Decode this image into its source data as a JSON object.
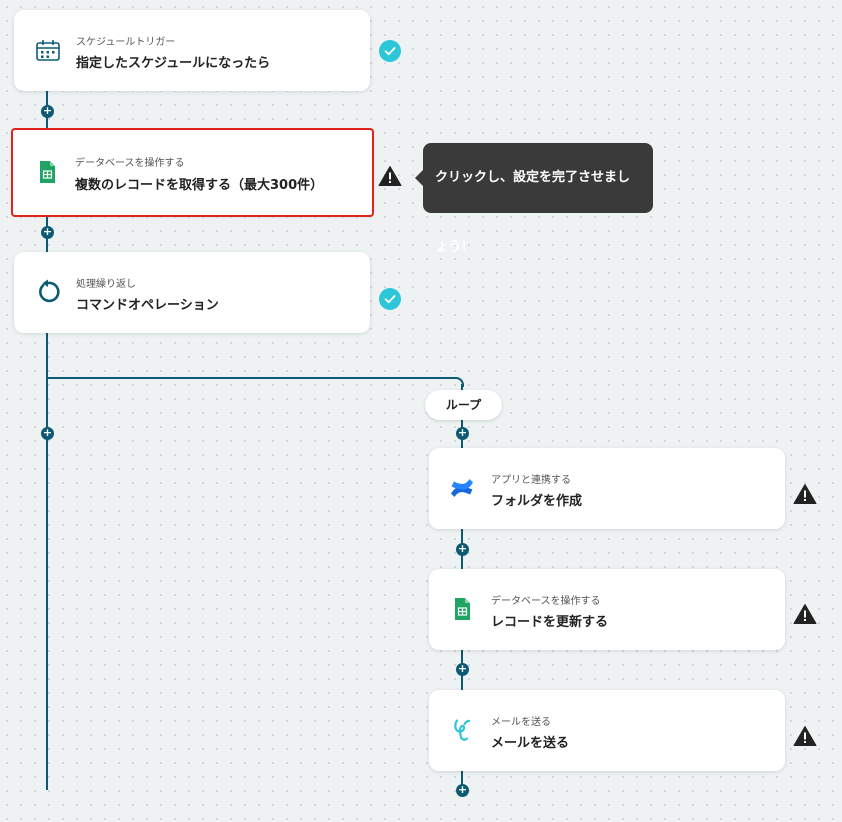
{
  "steps": [
    {
      "category": "スケジュールトリガー",
      "title": "指定したスケジュールになったら",
      "icon": "calendar-icon",
      "status": "complete"
    },
    {
      "category": "データベースを操作する",
      "title": "複数のレコードを取得する（最大300件）",
      "icon": "google-sheets-icon",
      "status": "warning"
    },
    {
      "category": "処理繰り返し",
      "title": "コマンドオペレーション",
      "icon": "loop-arrow-icon",
      "status": "complete"
    }
  ],
  "tooltip": "クリックし、設定を完了させましょう！",
  "loop": {
    "label": "ループ",
    "steps": [
      {
        "category": "アプリと連携する",
        "title": "フォルダを作成",
        "icon": "confluence-icon",
        "status": "warning"
      },
      {
        "category": "データベースを操作する",
        "title": "レコードを更新する",
        "icon": "google-sheets-icon",
        "status": "warning"
      },
      {
        "category": "メールを送る",
        "title": "メールを送る",
        "icon": "mail-icon",
        "status": "warning"
      }
    ]
  },
  "colors": {
    "connector": "#0d5b73",
    "check": "#2cc6d8",
    "selected_border": "#e0231b",
    "sheets_green": "#1fa463"
  }
}
